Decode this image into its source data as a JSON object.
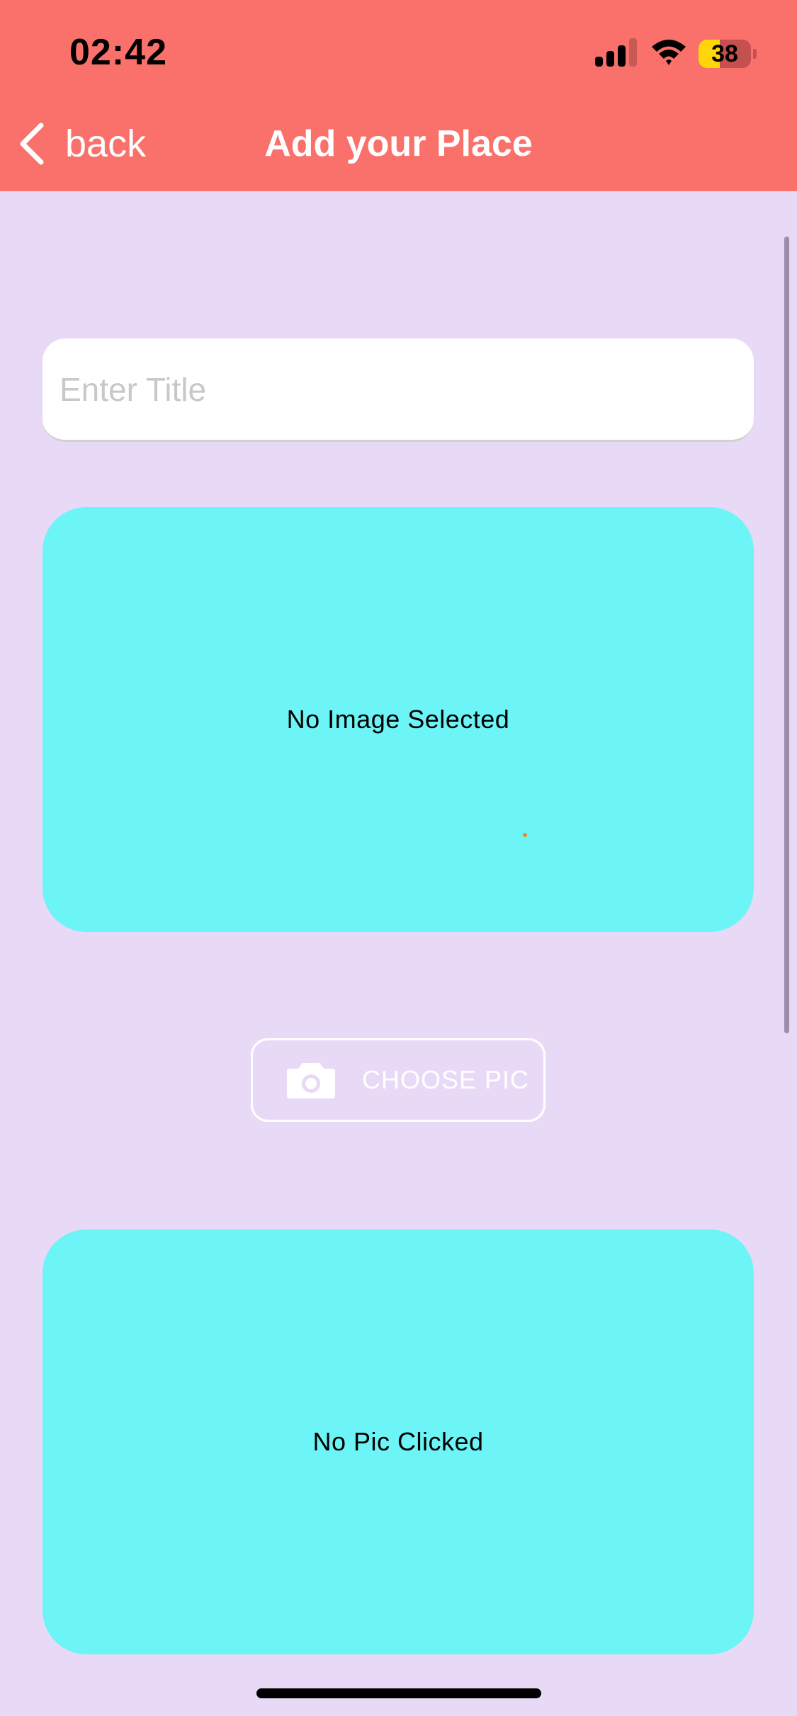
{
  "status_bar": {
    "time": "02:42",
    "battery_level": "38",
    "signal_icon": "cellular-signal-icon",
    "wifi_icon": "wifi-icon"
  },
  "header": {
    "back_label": "back",
    "title": "Add your Place",
    "background_color": "#fa706b"
  },
  "form": {
    "title_placeholder": "Enter Title",
    "title_value": "",
    "image_preview_text": "No Image Selected",
    "choose_pic_label": "CHOOSE PIC",
    "pic_preview_text": "No Pic Clicked"
  },
  "colors": {
    "page_background": "#e8daf6",
    "preview_background": "#6cf4f6"
  }
}
